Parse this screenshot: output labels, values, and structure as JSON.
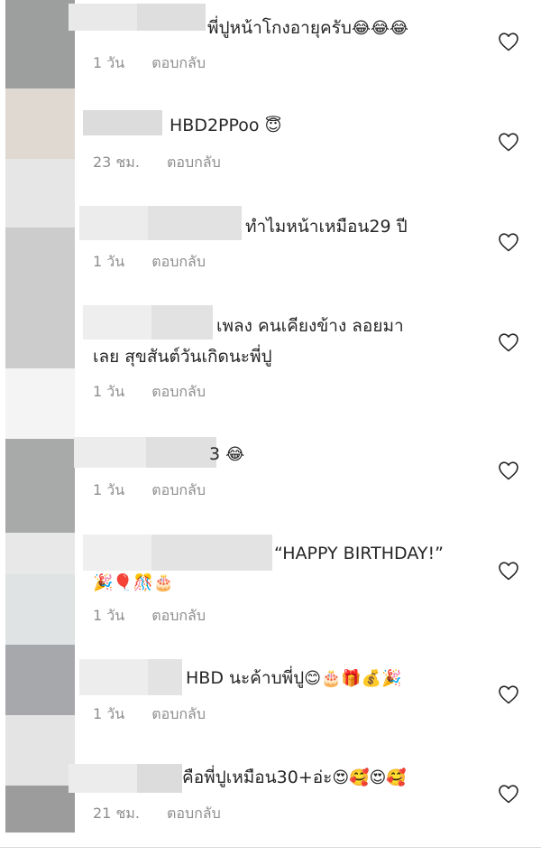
{
  "comments": [
    {
      "text": "พี่ปูหน้าโกงอายุครับ",
      "emoji": "😂😂😂",
      "time": "1 วัน",
      "reply": "ตอบกลับ"
    },
    {
      "text": "HBD2PPoo",
      "emoji": "😇",
      "time": "23 ชม.",
      "reply": "ตอบกลับ"
    },
    {
      "text": "ทำไมหน้าเหมือน29 ปี",
      "emoji": "",
      "time": "1 วัน",
      "reply": "ตอบกลับ"
    },
    {
      "text": "เพลง คนเคียงข้าง ลอยมา",
      "text2": "เลย สุขสันต์วันเกิดนะพี่ปู",
      "emoji": "",
      "time": "1 วัน",
      "reply": "ตอบกลับ"
    },
    {
      "text": "3",
      "emoji": "😂",
      "time": "1 วัน",
      "reply": "ตอบกลับ"
    },
    {
      "text": "“HAPPY BIRTHDAY!”",
      "emoji2": "🎉🎈🎊🎂",
      "time": "1 วัน",
      "reply": "ตอบกลับ"
    },
    {
      "text": "HBD นะค้าบพี่ปู",
      "emoji": "😊🎂🎁💰🎉",
      "time": "1 วัน",
      "reply": "ตอบกลับ"
    },
    {
      "text": "คือพี่ปูเหมือน30+อ่ะ",
      "emoji": "😍🥰😍🥰",
      "time": "21 ชม.",
      "reply": "ตอบกลับ"
    }
  ],
  "icons": {
    "like": "heart-outline-icon"
  },
  "colors": {
    "text": "#262626",
    "meta": "#8e8e8e",
    "heart": "#262626"
  }
}
